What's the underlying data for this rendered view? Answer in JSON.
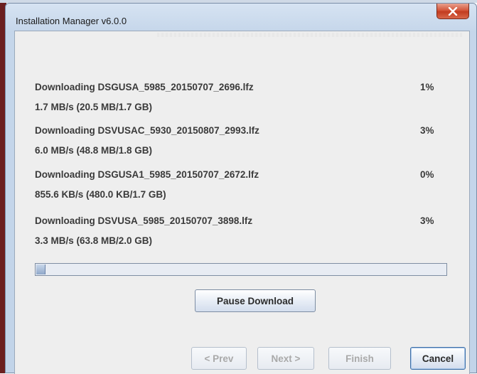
{
  "window": {
    "title": "Installation Manager v6.0.0"
  },
  "downloads": [
    {
      "file": "Downloading DSGUSA_5985_20150707_2696.lfz",
      "percent": "1%",
      "rate": "1.7 MB/s (20.5 MB/1.7 GB)"
    },
    {
      "file": "Downloading DSVUSAC_5930_20150807_2993.lfz",
      "percent": "3%",
      "rate": "6.0 MB/s (48.8 MB/1.8 GB)"
    },
    {
      "file": "Downloading DSGUSA1_5985_20150707_2672.lfz",
      "percent": "0%",
      "rate": "855.6 KB/s (480.0 KB/1.7 GB)"
    },
    {
      "file": "Downloading DSVUSA_5985_20150707_3898.lfz",
      "percent": "3%",
      "rate": "3.3 MB/s (63.8 MB/2.0 GB)"
    }
  ],
  "overall_progress": 0.02,
  "buttons": {
    "pause": "Pause Download",
    "prev": "< Prev",
    "next": "Next >",
    "finish": "Finish",
    "cancel": "Cancel"
  },
  "icons": {
    "close": "close-icon"
  },
  "colors": {
    "close_button": "#c84a2e",
    "progress_fill": "#8fa7c9"
  }
}
